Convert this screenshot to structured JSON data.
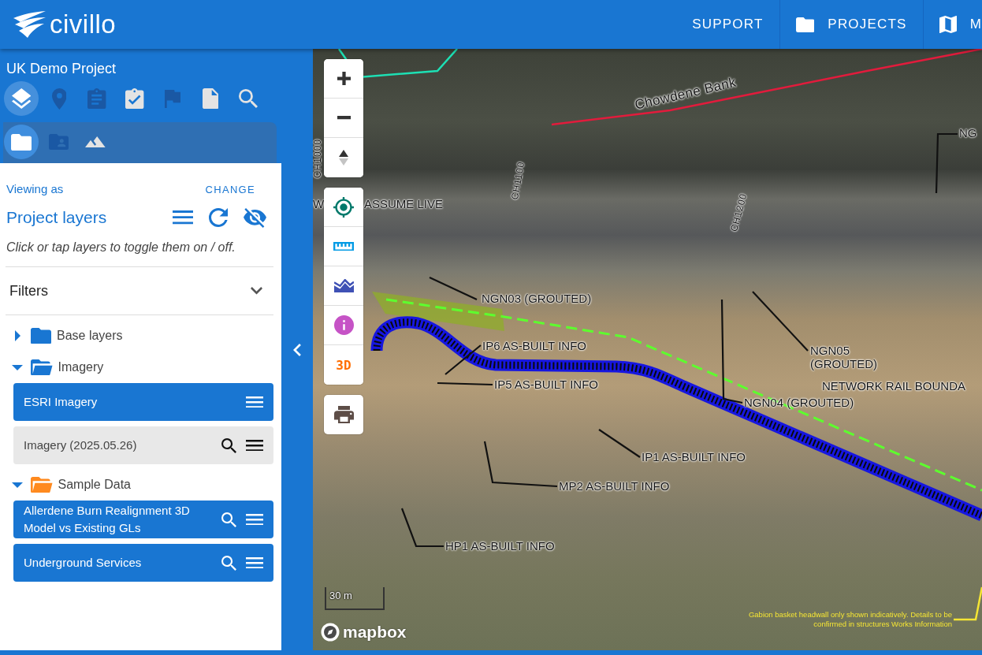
{
  "header": {
    "brand": "civillo",
    "nav": [
      {
        "label": "SUPPORT"
      },
      {
        "label": "PROJECTS"
      },
      {
        "label": "M"
      }
    ]
  },
  "sidebar": {
    "project": "UK Demo Project",
    "tabs": [
      {
        "selected": true,
        "color": "#ffffff"
      },
      {
        "selected": false,
        "color": "#1a58a4"
      },
      {
        "selected": false,
        "color": "#1a58a4"
      },
      {
        "selected": false,
        "color": "#e3e3e3"
      },
      {
        "selected": false,
        "color": "#1a58a4"
      },
      {
        "selected": false,
        "color": "#e3e3e3"
      },
      {
        "selected": false,
        "color": "#e3e3e3"
      }
    ],
    "subtabs": [
      {
        "selected": true,
        "color": "#ffffff"
      },
      {
        "selected": false,
        "color": "#1a58a4"
      },
      {
        "selected": false,
        "color": "#e3e3e3"
      }
    ]
  },
  "panel": {
    "viewing_as": "Viewing as",
    "change": "CHANGE",
    "title": "Project layers",
    "hint": "Click or tap layers to toggle them on / off.",
    "filters": {
      "label": "Filters",
      "expanded": false
    },
    "groups": [
      {
        "label": "Base layers",
        "expanded": false,
        "color": "#1976d2"
      },
      {
        "label": "Imagery",
        "expanded": true,
        "color": "#1976d2",
        "children": [
          {
            "label": "ESRI Imagery",
            "on": true,
            "zoom_to": false
          },
          {
            "label": "Imagery (2025.05.26)",
            "on": false,
            "zoom_to": true
          }
        ]
      },
      {
        "label": "Sample Data",
        "expanded": true,
        "color": "#ff8a1f",
        "children": [
          {
            "label": "Allerdene Burn Realignment 3D Model vs Existing GLs",
            "on": true,
            "zoom_to": true
          },
          {
            "label": "Underground Services",
            "on": true,
            "zoom_to": true
          }
        ]
      }
    ]
  },
  "map": {
    "three_d": "3D",
    "labels": [
      {
        "text": "Chowdene Bank",
        "kind": "street"
      },
      {
        "text": "NG",
        "kind": "callout"
      },
      {
        "text": "CH1000",
        "kind": "chainage"
      },
      {
        "text": "CH1100",
        "kind": "chainage"
      },
      {
        "text": "W",
        "kind": "callout"
      },
      {
        "text": "ASSUME LIVE",
        "kind": "callout"
      },
      {
        "text": "CH1200",
        "kind": "chainage"
      },
      {
        "text": "NGN03 (GROUTED)",
        "kind": "callout"
      },
      {
        "text": "IP6 AS-BUILT INFO",
        "kind": "callout"
      },
      {
        "text": "NGN05 (GROUTED)",
        "kind": "callout"
      },
      {
        "text": "IP5 AS-BUILT INFO",
        "kind": "callout"
      },
      {
        "text": "NETWORK RAIL BOUNDA",
        "kind": "callout"
      },
      {
        "text": "NGN04 (GROUTED)",
        "kind": "callout"
      },
      {
        "text": "IP1 AS-BUILT INFO",
        "kind": "callout"
      },
      {
        "text": "MP2 AS-BUILT INFO",
        "kind": "callout"
      },
      {
        "text": "HP1 AS-BUILT INFO",
        "kind": "callout"
      }
    ],
    "scale": "30 m",
    "attribution": "mapbox",
    "note": "Gabion basket headwall only shown indicatively. Details to be confirmed in structures Works Information"
  }
}
